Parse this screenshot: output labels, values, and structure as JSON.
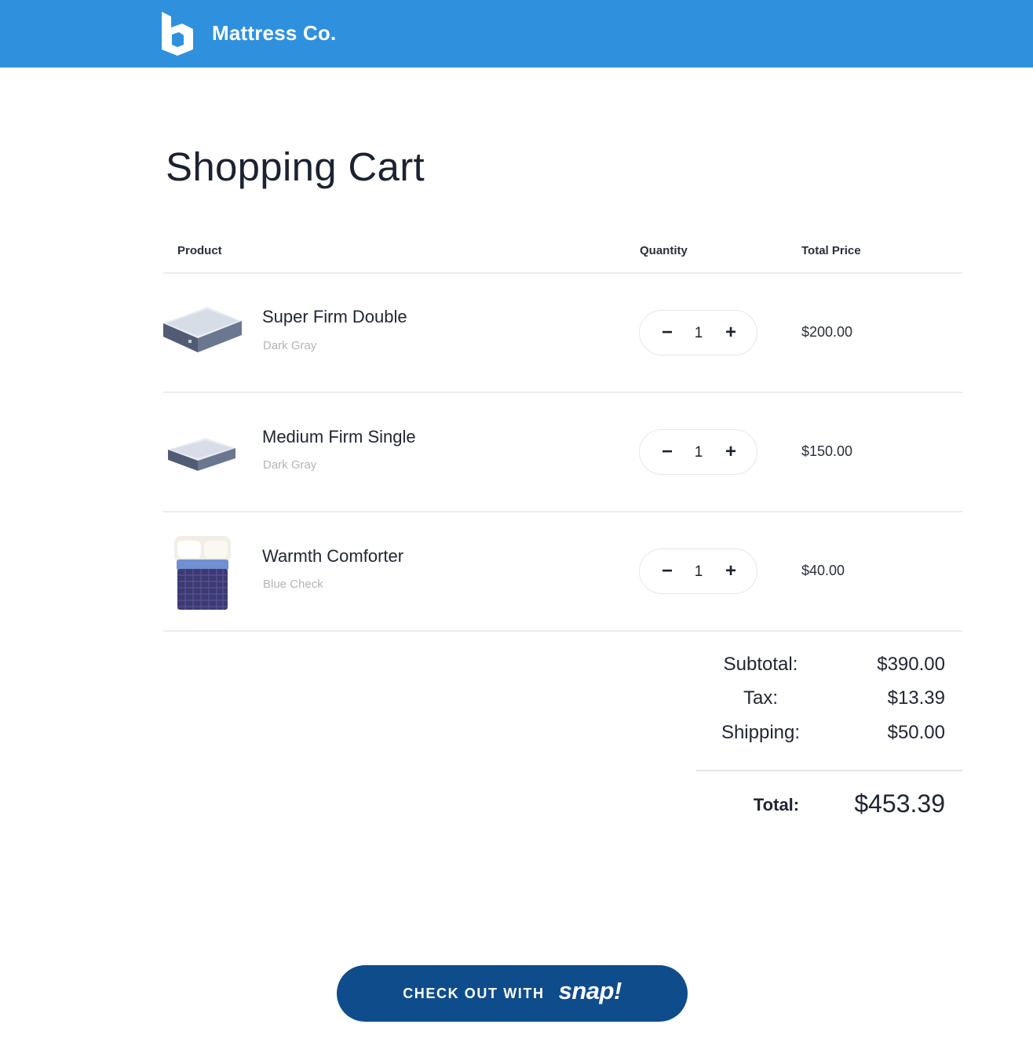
{
  "header": {
    "brand_name": "Mattress Co.",
    "brand_color": "#2f91de",
    "logo_icon": "logo-icon"
  },
  "page": {
    "title": "Shopping Cart"
  },
  "table": {
    "columns": [
      "Product",
      "Quantity",
      "Total Price"
    ]
  },
  "cart": {
    "items": [
      {
        "name": "Super Firm Double",
        "variant": "Dark Gray",
        "quantity": "1",
        "price": "$200.00",
        "image": "mattress-icon"
      },
      {
        "name": "Medium Firm Single",
        "variant": "Dark Gray",
        "quantity": "1",
        "price": "$150.00",
        "image": "mattress-icon"
      },
      {
        "name": "Warmth  Comforter",
        "variant": "Blue Check",
        "quantity": "1",
        "price": "$40.00",
        "image": "comforter-icon"
      }
    ],
    "stepper": {
      "minus": "−",
      "plus": "+"
    }
  },
  "summary": {
    "subtotal_label": "Subtotal:",
    "subtotal_value": "$390.00",
    "tax_label": "Tax:",
    "tax_value": "$13.39",
    "shipping_label": "Shipping:",
    "shipping_value": "$50.00",
    "total_label": "Total:",
    "total_value": "$453.39"
  },
  "checkout": {
    "label": "CHECK OUT WITH",
    "wordmark": "snap!",
    "color": "#0f4c8c"
  }
}
